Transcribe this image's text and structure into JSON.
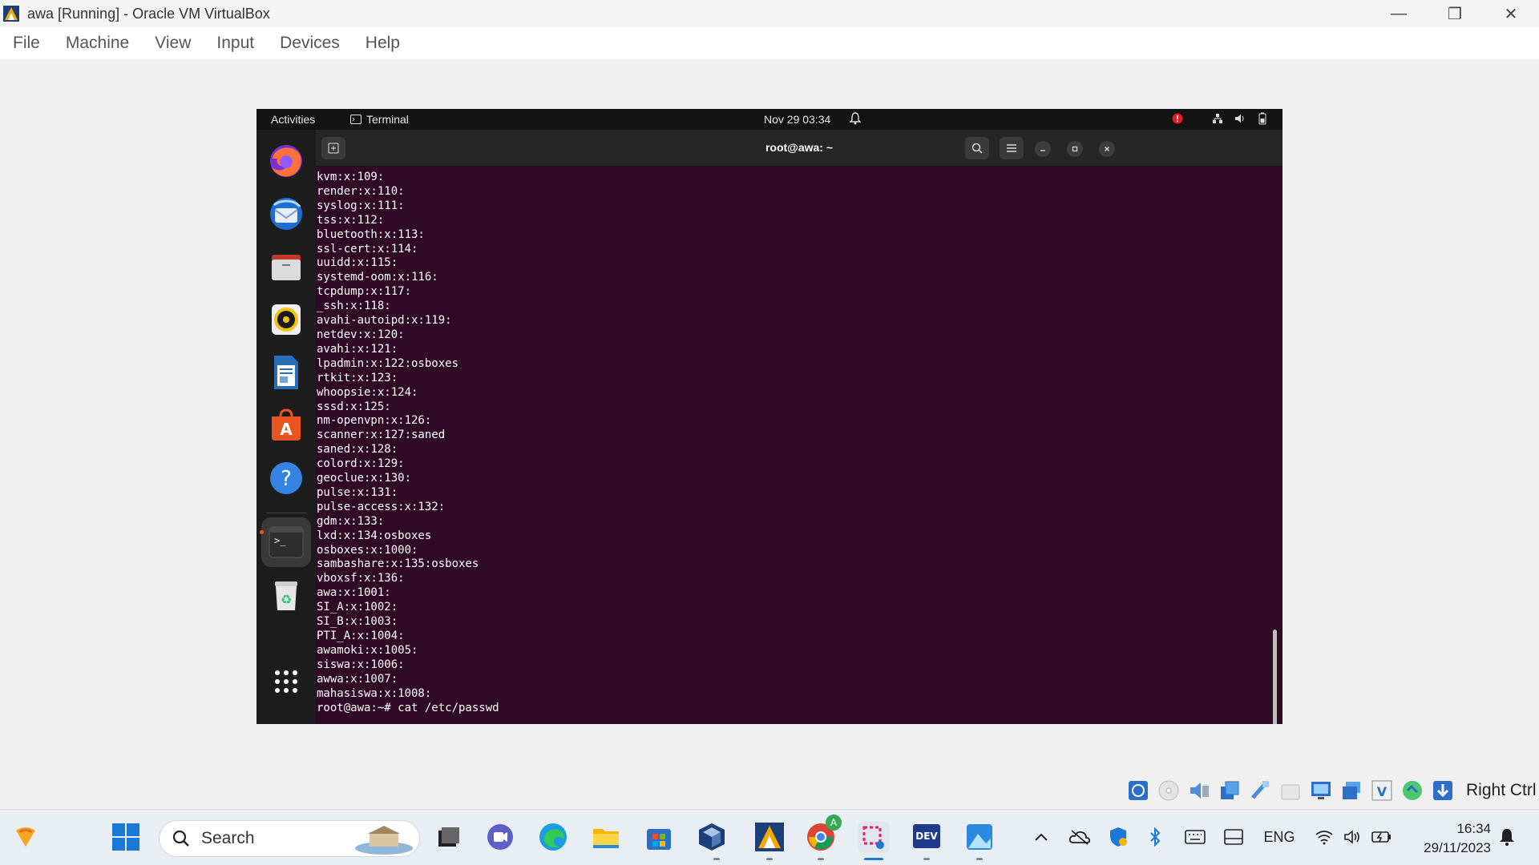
{
  "window": {
    "title": "awa [Running] - Oracle VM VirtualBox",
    "controls": {
      "minimize": "—",
      "restore": "❐",
      "close": "✕"
    }
  },
  "menubar": {
    "items": [
      {
        "label": "File"
      },
      {
        "label": "Machine"
      },
      {
        "label": "View"
      },
      {
        "label": "Input"
      },
      {
        "label": "Devices"
      },
      {
        "label": "Help"
      }
    ]
  },
  "guest": {
    "topbar": {
      "activities": "Activities",
      "app_name": "Terminal",
      "clock": "Nov 29  03:34"
    },
    "terminal": {
      "title": "root@awa: ~",
      "lines": [
        "kvm:x:109:",
        "render:x:110:",
        "syslog:x:111:",
        "tss:x:112:",
        "bluetooth:x:113:",
        "ssl-cert:x:114:",
        "uuidd:x:115:",
        "systemd-oom:x:116:",
        "tcpdump:x:117:",
        "_ssh:x:118:",
        "avahi-autoipd:x:119:",
        "netdev:x:120:",
        "avahi:x:121:",
        "lpadmin:x:122:osboxes",
        "rtkit:x:123:",
        "whoopsie:x:124:",
        "sssd:x:125:",
        "nm-openvpn:x:126:",
        "scanner:x:127:saned",
        "saned:x:128:",
        "colord:x:129:",
        "geoclue:x:130:",
        "pulse:x:131:",
        "pulse-access:x:132:",
        "gdm:x:133:",
        "lxd:x:134:osboxes",
        "osboxes:x:1000:",
        "sambashare:x:135:osboxes",
        "vboxsf:x:136:",
        "awa:x:1001:",
        "SI_A:x:1002:",
        "SI_B:x:1003:",
        "PTI_A:x:1004:",
        "awamoki:x:1005:",
        "siswa:x:1006:",
        "awwa:x:1007:",
        "mahasiswa:x:1008:",
        "root@awa:~# cat /etc/passwd"
      ]
    },
    "dock": [
      "firefox-icon",
      "thunderbird-icon",
      "files-icon",
      "rhythmbox-icon",
      "writer-icon",
      "app-center-icon",
      "help-icon",
      "terminal-icon",
      "trash-icon",
      "show-apps-icon"
    ]
  },
  "vbox_status": {
    "host_key": "Right Ctrl"
  },
  "taskbar": {
    "search_label": "Search",
    "language": "ENG",
    "time": "16:34",
    "date": "29/11/2023",
    "chrome_badge": "A"
  },
  "colors": {
    "terminal_bg": "#300a24",
    "accent": "#e95420",
    "taskbar_bg": "#e9eef5"
  }
}
